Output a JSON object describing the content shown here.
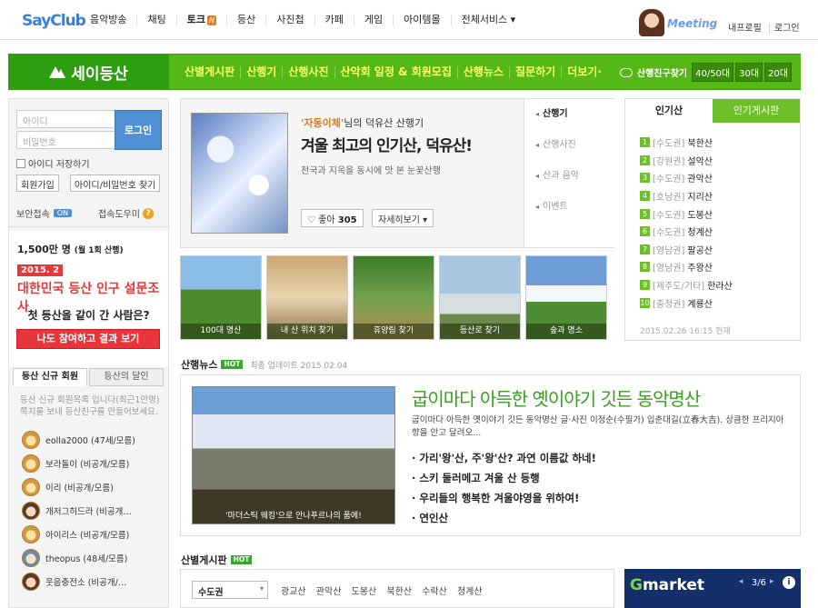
{
  "header": {
    "logo": "SayClub",
    "nav": [
      "음악방송",
      "채팅",
      "토크",
      "등산",
      "사진첩",
      "카페",
      "게임",
      "아이템몰",
      "전체서비스"
    ],
    "talk_badge": "N",
    "meeting": "Meeting",
    "links": [
      "내프로필",
      "로그인"
    ]
  },
  "greenbar": {
    "title": "세이등산",
    "menu": [
      "산별게시판",
      "산행기",
      "산행사진",
      "산악회 일정 & 회원모집",
      "산행뉴스",
      "질문하기",
      "더보기"
    ],
    "friend_label": "산행친구찾기",
    "ages": [
      "40/50대",
      "30대",
      "20대"
    ]
  },
  "login": {
    "id_placeholder": "아이디",
    "pw_placeholder": "비밀번호",
    "login_button": "로그인",
    "save_id": "아이디 저장하기",
    "join": "회원가입",
    "find": "아이디/비밀번호 찾기",
    "security": "보안접속",
    "security_on": "ON",
    "help": "접속도우미"
  },
  "survey": {
    "count": "1,500만 명",
    "count_note": "(월 1회 산행)",
    "date": "2015. 2",
    "title": "대한민국 등산 인구 설문조사",
    "question": "첫 등산을 같이 간 사람은?",
    "button": "나도 참여하고 결과 보기"
  },
  "members": {
    "tabs": [
      "등산 신규 회원",
      "등산의 달인"
    ],
    "note": "등산 신규 회원목록 입니다(최근1만명) 쪽지를 보내 등산친구를 만들어보세요.",
    "list": [
      "eolla2000 (47세/모름)",
      "보라돌이 (비공개/모름)",
      "이리 (비공개/모름)",
      "개저그히드라 (비공개…",
      "아이리스 (비공개/모름)",
      "theopus (48세/모름)",
      "웃음충전소 (비공개/…"
    ]
  },
  "feature": {
    "author": "'자동이체'",
    "author_suffix": "님의 덕유산 산행기",
    "title": "겨울 최고의 인기산, 덕유산!",
    "desc": "천국과 지옥을 동시에 맛 본 눈꽃산행",
    "like_label": "좋아",
    "like_count": "305",
    "more": "자세히보기",
    "links": [
      "산행기",
      "산행사진",
      "산과 음악",
      "이벤트"
    ]
  },
  "thumbs": [
    "100대 명산",
    "내 산 위치 찾기",
    "휴양림 찾기",
    "등산로 찾기",
    "숲과 명소"
  ],
  "ranking": {
    "tabs": [
      "인기산",
      "인기게시판"
    ],
    "items": [
      {
        "num": "1",
        "region": "[수도권]",
        "name": "북한산"
      },
      {
        "num": "2",
        "region": "[강원권]",
        "name": "설악산"
      },
      {
        "num": "3",
        "region": "[수도권]",
        "name": "관악산"
      },
      {
        "num": "4",
        "region": "[호남권]",
        "name": "지리산"
      },
      {
        "num": "5",
        "region": "[수도권]",
        "name": "도봉산"
      },
      {
        "num": "6",
        "region": "[수도권]",
        "name": "청계산"
      },
      {
        "num": "7",
        "region": "[영남권]",
        "name": "팔공산"
      },
      {
        "num": "8",
        "region": "[영남권]",
        "name": "주왕산"
      },
      {
        "num": "9",
        "region": "[제주도/기타]",
        "name": "한라산"
      },
      {
        "num": "10",
        "region": "[충청권]",
        "name": "계룡산"
      }
    ],
    "date": "2015.02.26 16:15 현재"
  },
  "news": {
    "heading": "산행뉴스",
    "hot": "HOT",
    "updated": "최종 업데이트 2015.02.04",
    "caption": "'마더스틱 웨킹'으로 안나푸르나의 품에!",
    "title": "굽이마다 아득한 옛이야기 깃든 동악명산",
    "desc": "굽이마다 아득한 옛이야기 깃든 동악명산 글·사진 이정순(수필가) 입춘대길(立春大吉). 상큼한 프리지아 향을 안고 달려오...",
    "bullets": [
      "· 가리'왕'산, 주'왕'산? 과연 이름값 하네!",
      "· 스키 둘러메고 겨울 산 등행",
      "· 우리들의 행복한 겨울야영을 위하여!",
      "· 연인산"
    ]
  },
  "board": {
    "heading": "산별게시판",
    "hot": "HOT",
    "select": "수도권",
    "links": [
      "광교산",
      "관악산",
      "도봉산",
      "북한산",
      "수락산",
      "청계산"
    ]
  },
  "ad": {
    "logo_g": "G",
    "logo_rest": "market",
    "page": "3/6",
    "info": "i"
  }
}
